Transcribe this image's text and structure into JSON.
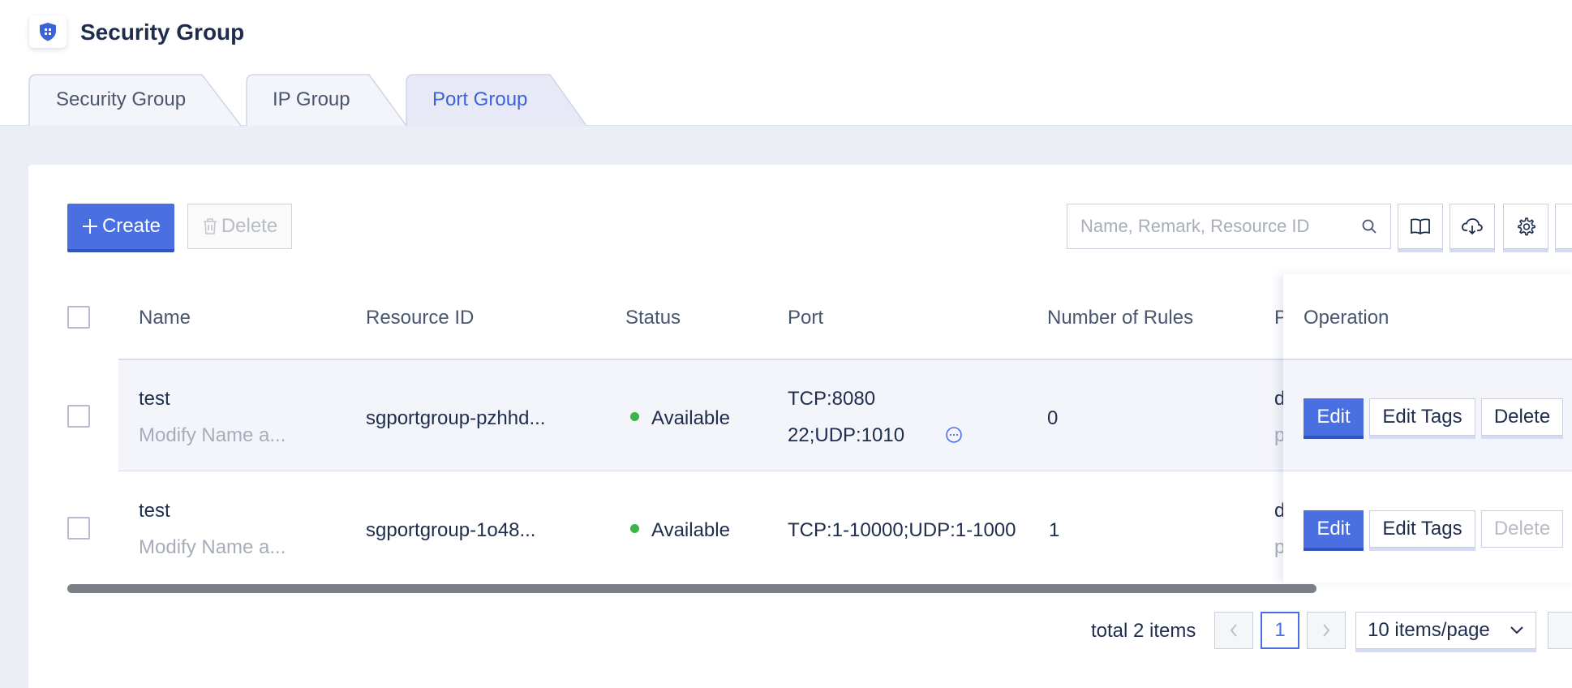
{
  "header": {
    "title": "Security Group"
  },
  "tabs": [
    {
      "label": "Security Group",
      "active": false
    },
    {
      "label": "IP Group",
      "active": false
    },
    {
      "label": "Port Group",
      "active": true
    }
  ],
  "toolbar": {
    "create_label": "Create",
    "delete_label": "Delete",
    "search_placeholder": "Name, Remark, Resource ID",
    "icons": [
      "book-icon",
      "cloud-download-icon",
      "gear-icon",
      "more-icon"
    ]
  },
  "table": {
    "columns": [
      "Name",
      "Resource ID",
      "Status",
      "Port",
      "Number of Rules",
      "P",
      "Operation"
    ],
    "rows": [
      {
        "name": "test",
        "remark": "Modify Name a...",
        "resource_id": "sgportgroup-pzhhd...",
        "status": "Available",
        "port_line1": "TCP:8080",
        "port_line2": "22;UDP:1010",
        "rules": "0",
        "p_line1": "d",
        "p_line2": "p",
        "edit": "Edit",
        "edit_tags": "Edit Tags",
        "delete": "Delete",
        "delete_enabled": true
      },
      {
        "name": "test",
        "remark": "Modify Name a...",
        "resource_id": "sgportgroup-1o48...",
        "status": "Available",
        "port_line1": "TCP:1-10000;UDP:1-1000",
        "port_line2": "",
        "rules": "1",
        "p_line1": "d",
        "p_line2": "p",
        "edit": "Edit",
        "edit_tags": "Edit Tags",
        "delete": "Delete",
        "delete_enabled": false
      }
    ]
  },
  "pagination": {
    "total_text": "total 2 items",
    "current_page": "1",
    "page_size": "10 items/page"
  },
  "colors": {
    "primary": "#4a6fe0",
    "status_available": "#3bb54a",
    "active_tab": "#3b62d8"
  }
}
